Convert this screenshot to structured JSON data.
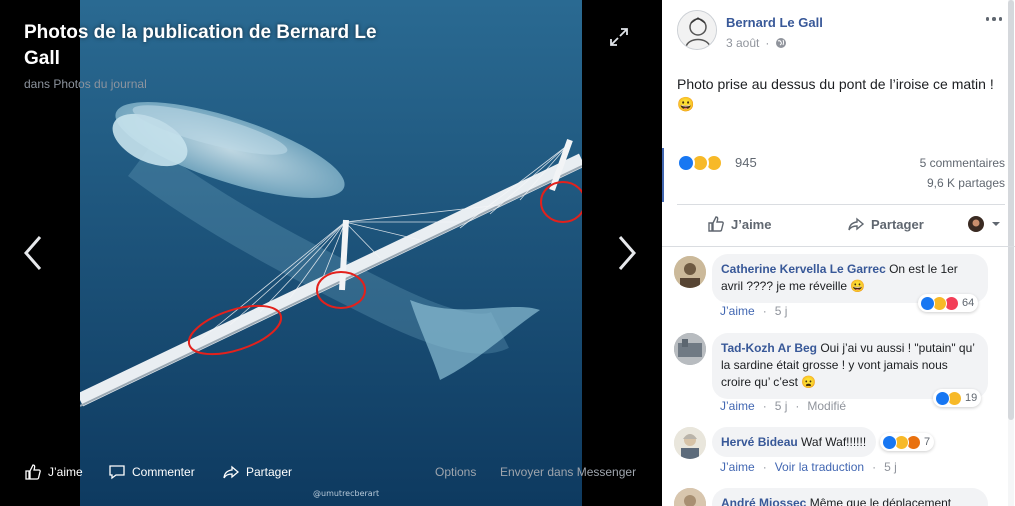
{
  "viewer": {
    "title": "Photos de la publication de Bernard Le Gall",
    "subtitle": "dans Photos du journal",
    "photo_credit": "@umutrecberart",
    "actions": {
      "like": "J’aime",
      "comment": "Commenter",
      "share": "Partager",
      "options": "Options",
      "messenger": "Envoyer dans Messenger"
    }
  },
  "post": {
    "author": "Bernard Le Gall",
    "date": "3 août",
    "text": "Photo prise au dessus du pont de l’iroise ce matin !",
    "text_emoji": "😀",
    "reaction_count": "945",
    "comments_count": "5 commentaires",
    "shares_count": "9,6 K partages",
    "actions": {
      "like": "J’aime",
      "share": "Partager"
    }
  },
  "comments": [
    {
      "author": "Catherine Kervella Le Garrec",
      "text": "On est le 1er avril ???? je me réveille",
      "emoji": "😀",
      "like": "J’aime",
      "time": "5 j",
      "reactions": "64"
    },
    {
      "author": "Tad-Kozh Ar Beg",
      "text": "Oui j’ai vu aussi ! \"putain\" qu’ la sardine était grosse ! y vont jamais nous croire qu’ c’est",
      "emoji": "😦",
      "like": "J’aime",
      "time": "5 j",
      "modified": "Modifié",
      "reactions": "19"
    },
    {
      "author": "Hervé Bideau",
      "text": "Waf Waf!!!!!!",
      "like": "J’aime",
      "translate": "Voir la traduction",
      "time": "5 j",
      "reactions": "7"
    },
    {
      "author": "André Miossec",
      "text": "Même que le déplacement"
    }
  ],
  "colors": {
    "link_blue": "#385898",
    "accent_blue": "#4267b2",
    "meta_gray": "#90949c",
    "bubble_gray": "#f2f3f5"
  }
}
